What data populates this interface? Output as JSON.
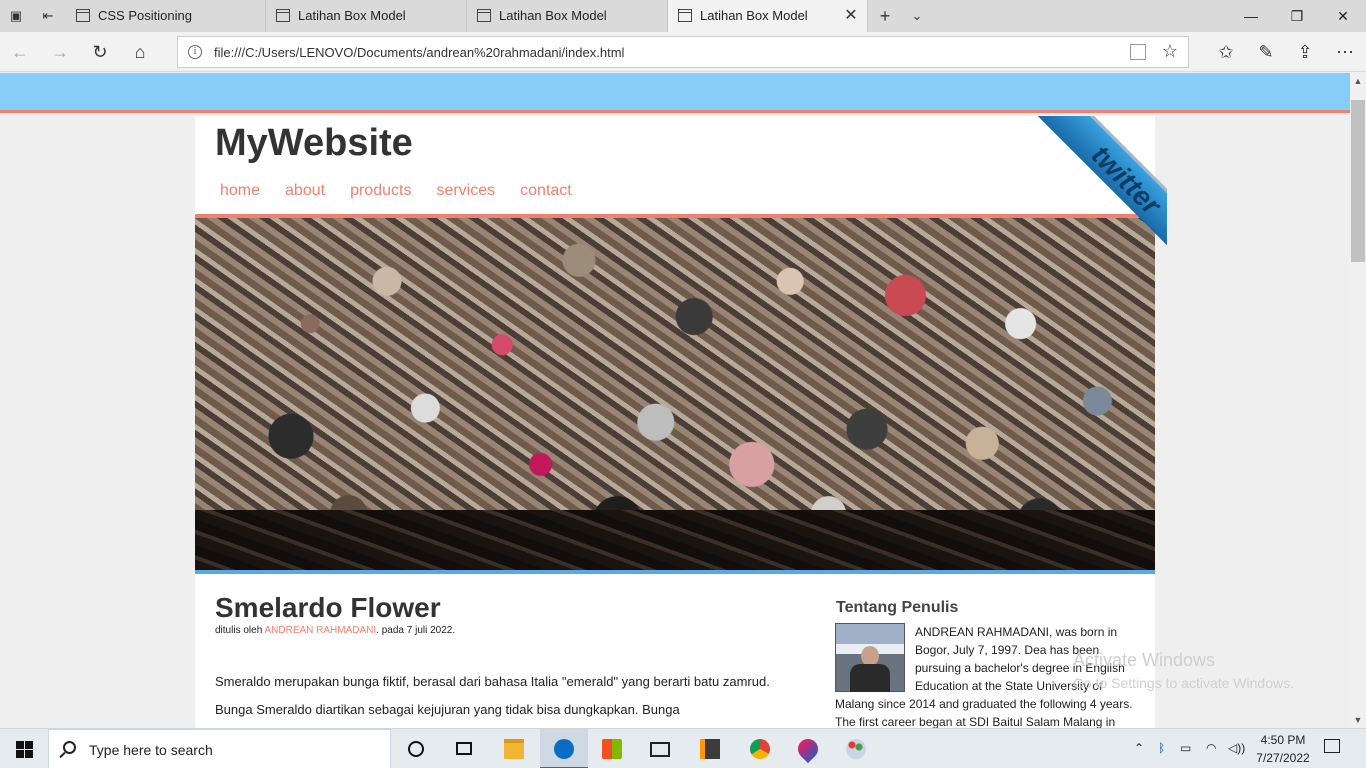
{
  "browser": {
    "tabs": [
      {
        "label": "CSS Positioning"
      },
      {
        "label": "Latihan Box Model"
      },
      {
        "label": "Latihan Box Model"
      },
      {
        "label": "Latihan Box Model"
      }
    ],
    "active_tab_index": 3,
    "url": "file:///C:/Users/LENOVO/Documents/andrean%20rahmadani/index.html",
    "icons": {
      "tab_manager": "tab-set-aside-icon",
      "back": "back-arrow-icon",
      "forward": "forward-arrow-icon",
      "refresh": "refresh-icon",
      "home": "home-icon",
      "favorite": "star-icon",
      "favorites_hub": "favorites-list-icon",
      "notes": "pen-icon",
      "share": "share-icon",
      "more": "more-icon"
    }
  },
  "page": {
    "site_title": "MyWebsite",
    "menu": [
      "home",
      "about",
      "products",
      "services",
      "contact"
    ],
    "ribbon_text": "twitter",
    "post": {
      "title": "Smelardo Flower",
      "meta_prefix": "ditulis oleh ",
      "meta_author": "ANDREAN RAHMADANI",
      "meta_suffix": ". pada 7 juli 2022.",
      "body": "Smeraldo merupakan bunga fiktif, berasal dari bahasa Italia \"emerald\" yang berarti batu zamrud. Bunga Smeraldo diartikan sebagai kejujuran yang tidak bisa dungkapkan. Bunga"
    },
    "sidebar": {
      "title": "Tentang Penulis",
      "bio": "ANDREAN RAHMADANI, was born in Bogor, July 7, 1997. Dea has been pursuing a bachelor's degree in English Education at the State University of Malang since 2014 and graduated the following 4 years. The first career began at SDI Baitul Salam Malang in"
    },
    "colors": {
      "accent": "#f08070",
      "top_band": "#87cdf9",
      "banner_rule": "#5aa9e6"
    }
  },
  "watermark": {
    "line1": "Activate Windows",
    "line2": "Go to Settings to activate Windows."
  },
  "taskbar": {
    "search_placeholder": "Type here to search",
    "time": "4:50 PM",
    "date": "7/27/2022"
  }
}
